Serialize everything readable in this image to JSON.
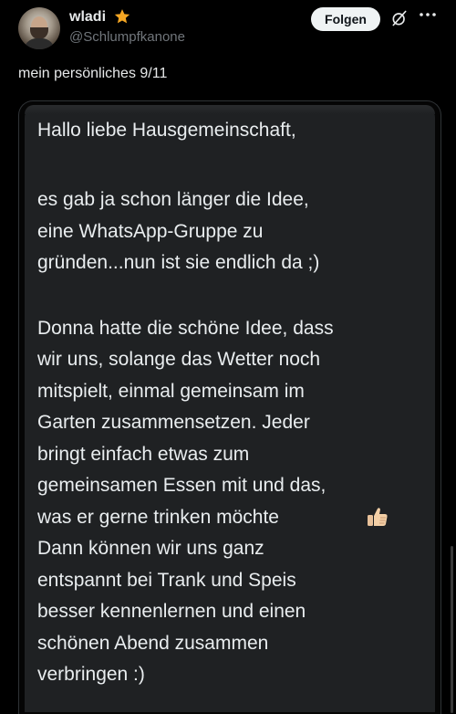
{
  "author": {
    "name": "wladi",
    "handle": "@Schlumpfkanone",
    "verified_icon": "star-icon",
    "accent_color": "#f5a623"
  },
  "actions": {
    "follow_label": "Folgen",
    "grok_icon": "grok-icon",
    "more_icon": "more-icon"
  },
  "post": {
    "text": "mein persönliches 9/11"
  },
  "message": {
    "lines": [
      "Hallo liebe Hausgemeinschaft,",
      "es gab ja schon länger die Idee,",
      "eine WhatsApp-Gruppe zu",
      "gründen...nun ist sie endlich da ;)",
      "Donna hatte die schöne Idee, dass",
      "wir uns, solange das Wetter noch",
      "mitspielt, einmal gemeinsam im",
      "Garten zusammensetzen. Jeder",
      "bringt einfach etwas zum",
      "gemeinsamen Essen mit und das,",
      "was er gerne trinken möchte",
      "Dann können wir uns ganz",
      "entspannt bei Trank und Speis",
      "besser kennenlernen und einen",
      "schönen Abend zusammen",
      "verbringen :)"
    ],
    "emoji_icon": "thumbs-up-icon"
  },
  "colors": {
    "background": "#000000",
    "bubble": "#1f2123",
    "text": "#e7e9ea",
    "secondary_text": "#71767b",
    "follow_bg": "#eff3f4"
  }
}
